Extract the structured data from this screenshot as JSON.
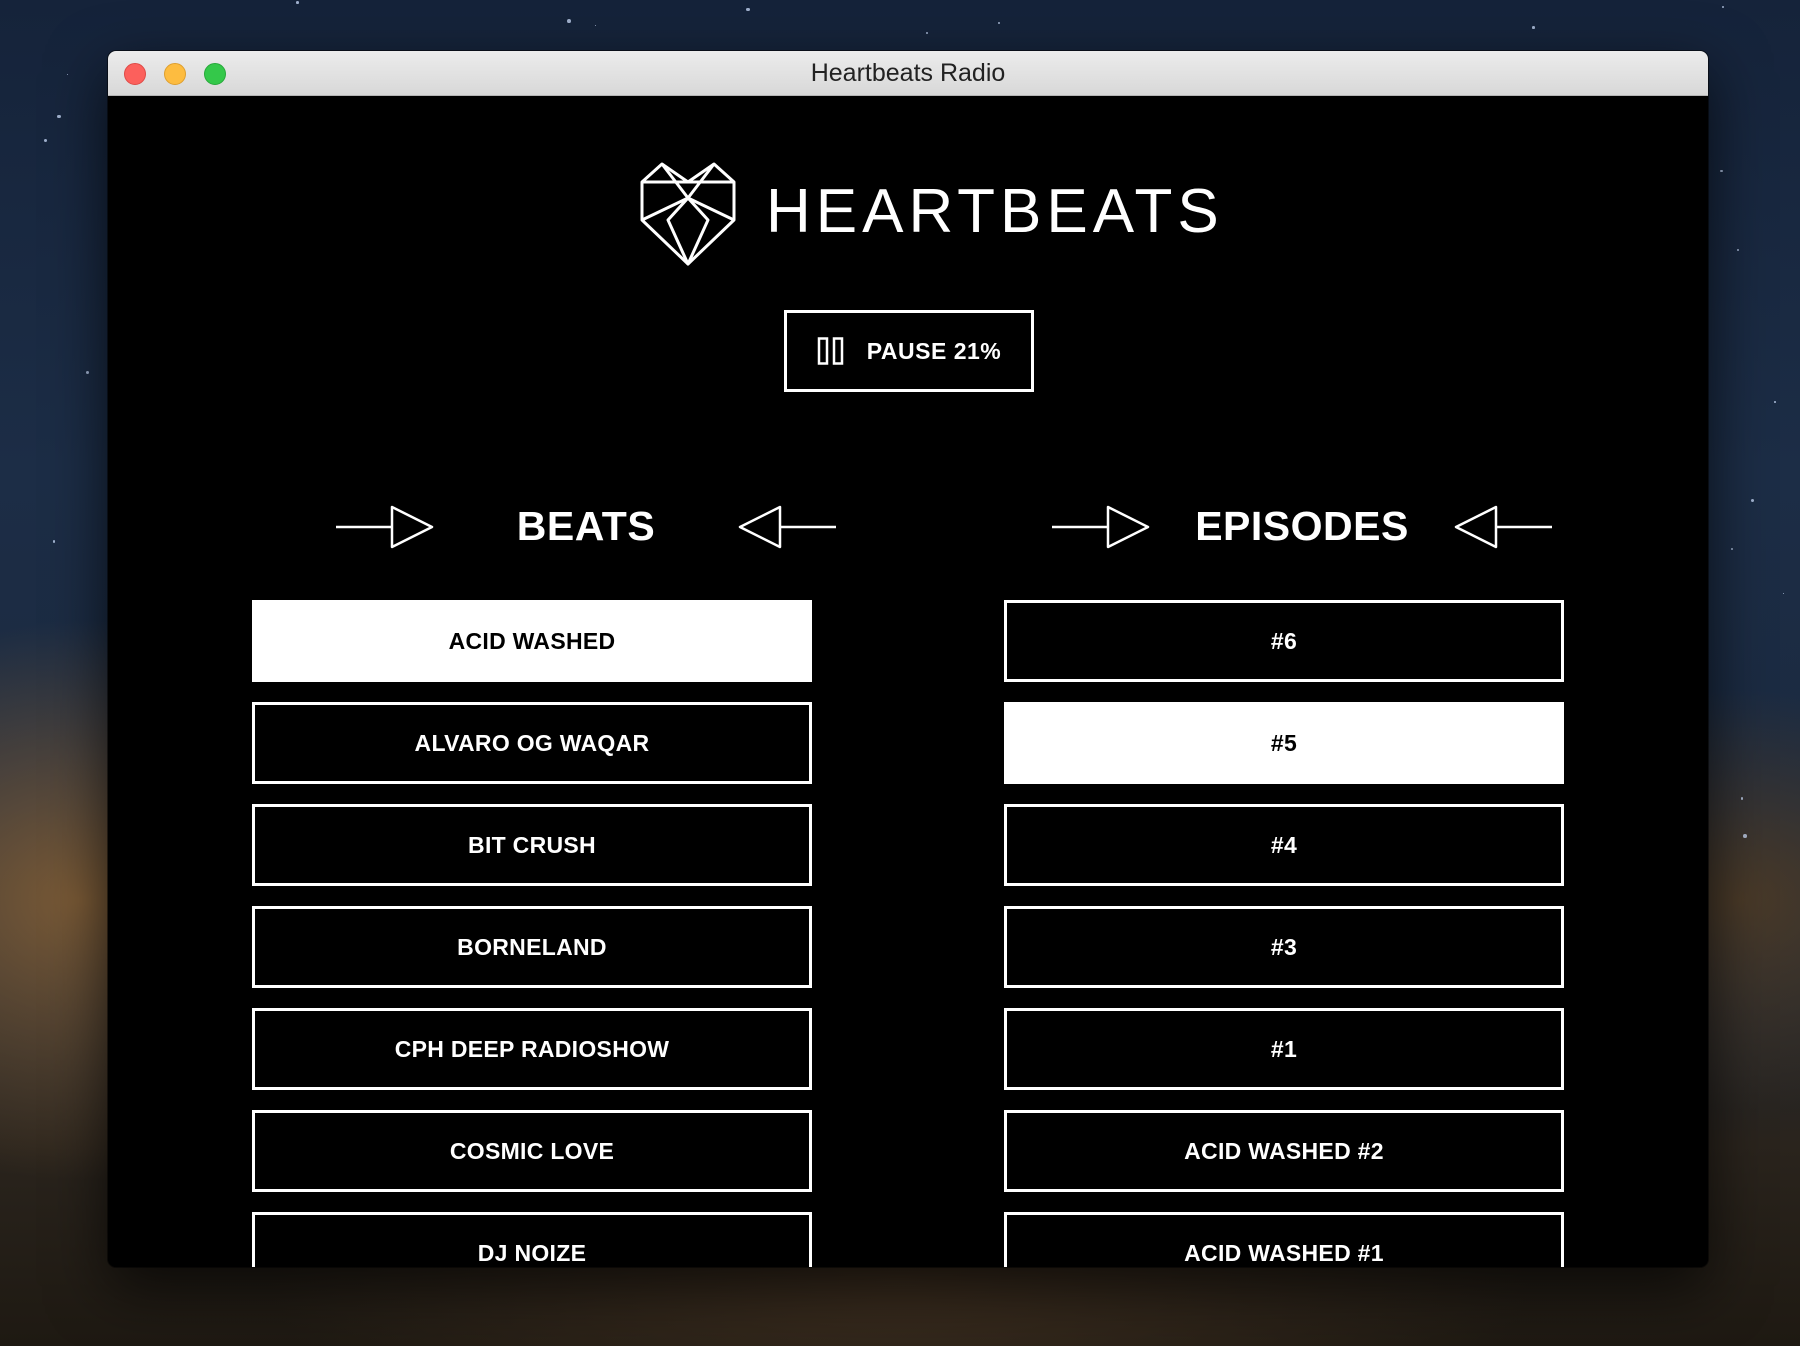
{
  "window": {
    "title": "Heartbeats Radio"
  },
  "brand": {
    "name": "HEARTBEATS",
    "logo_icon": "heart-diamond-icon"
  },
  "player": {
    "pause_label": "PAUSE 21%",
    "icon": "pause-icon",
    "progress_percent": 21
  },
  "beats": {
    "title": "BEATS",
    "selected_index": 0,
    "items": [
      "ACID WASHED",
      "ALVARO OG WAQAR",
      "BIT CRUSH",
      "BORNELAND",
      "CPH DEEP RADIOSHOW",
      "COSMIC LOVE",
      "DJ NOIZE"
    ]
  },
  "episodes": {
    "title": "EPISODES",
    "selected_index": 1,
    "items": [
      "#6",
      "#5",
      "#4",
      "#3",
      "#1",
      "ACID WASHED #2",
      "ACID WASHED #1"
    ]
  },
  "colors": {
    "background": "#000000",
    "foreground": "#ffffff"
  }
}
